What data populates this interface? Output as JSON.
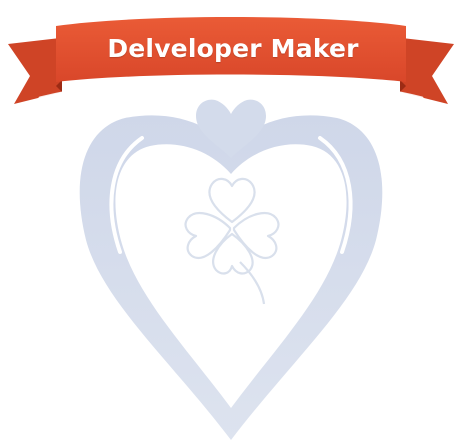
{
  "badge": {
    "title": "Delveloper Maker",
    "icons": {
      "heart": "heart-outline-icon",
      "top_heart": "small-heart-icon",
      "clover": "four-leaf-clover-icon",
      "ribbon": "ribbon-banner"
    },
    "colors": {
      "ribbon_front": "#e2502d",
      "ribbon_tail": "#c63f22",
      "ribbon_fold": "#9c2b14",
      "heart_fill": "#d5dceb",
      "clover_stroke": "#d7deeb",
      "background": "#ffffff"
    }
  }
}
